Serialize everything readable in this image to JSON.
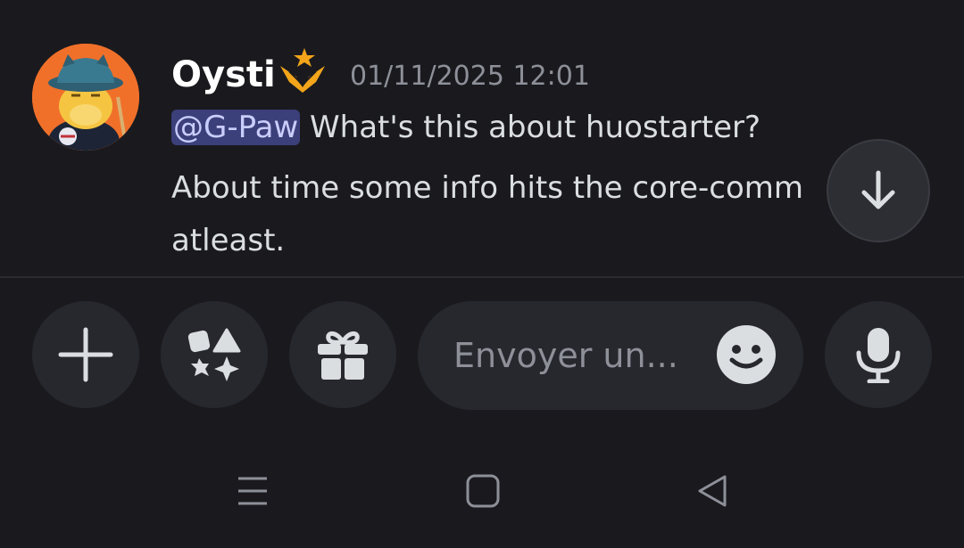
{
  "message": {
    "author": "Oysti",
    "timestamp": "01/11/2025 12:01",
    "mention": "@G-Paw",
    "line1_rest": " What's this about huostarter?",
    "line2": "About time some info hits the core-comm",
    "line3": "atleast.",
    "avatar_icon": "cat-hat-avatar",
    "badge_icon": "gold-wing-star-badge-icon"
  },
  "composer": {
    "placeholder": "Envoyer un...",
    "plus_icon": "plus-icon",
    "apps_icon": "apps-icon",
    "gift_icon": "gift-icon",
    "emoji_icon": "emoji-icon",
    "mic_icon": "microphone-icon"
  },
  "colors": {
    "background": "#1a1a1e",
    "button_bg": "#27282e",
    "mention_bg": "#3b3f7a",
    "mention_text": "#c9cdfb",
    "badge_gold": "#f2a51a"
  }
}
